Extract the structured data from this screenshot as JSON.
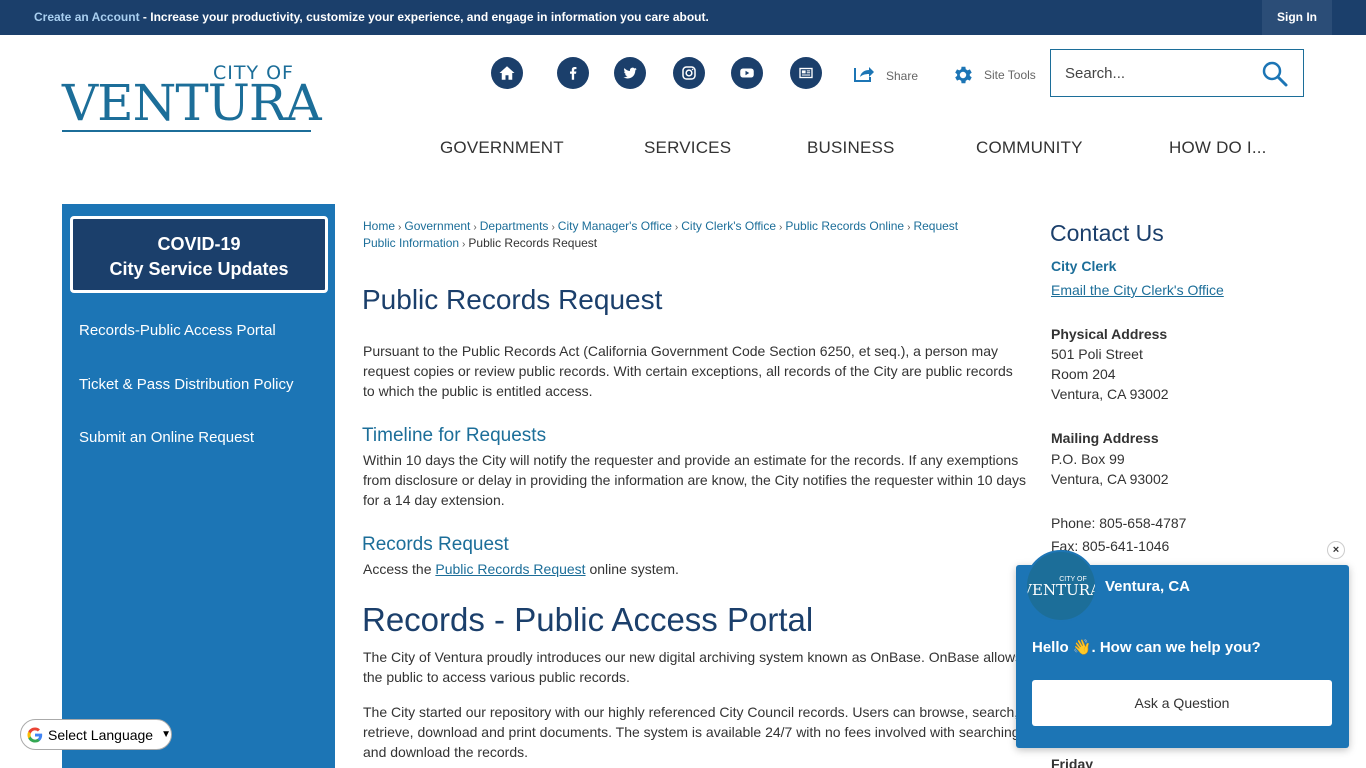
{
  "topbar": {
    "account_link": "Create an Account",
    "message": " - Increase your productivity, customize your experience, and engage in information you care about.",
    "signin": "Sign In"
  },
  "logo": {
    "city_of": "CITY OF",
    "name": "VENTURA"
  },
  "social": [
    {
      "icon": "home-icon"
    },
    {
      "icon": "facebook-icon"
    },
    {
      "icon": "twitter-icon"
    },
    {
      "icon": "instagram-icon"
    },
    {
      "icon": "youtube-icon"
    },
    {
      "icon": "news-icon"
    }
  ],
  "utility": {
    "share": "Share",
    "site_tools": "Site Tools"
  },
  "search": {
    "placeholder": "Search..."
  },
  "nav": [
    "GOVERNMENT",
    "SERVICES",
    "BUSINESS",
    "COMMUNITY",
    "HOW DO I..."
  ],
  "sidebar": {
    "covid_line1": "COVID-19",
    "covid_line2": "City Service Updates",
    "links": [
      "Records-Public Access Portal",
      "Ticket & Pass Distribution Policy",
      "Submit an Online Request"
    ]
  },
  "breadcrumb": {
    "items": [
      "Home",
      "Government",
      "Departments",
      "City Manager's Office",
      "City Clerk's Office",
      "Public Records Online",
      "Request",
      "Public Information"
    ],
    "current": "Public Records Request"
  },
  "main": {
    "title": "Public Records Request",
    "intro": " Pursuant to the Public Records Act (California Government Code Section 6250, et seq.), a person may request copies or review public records. With certain exceptions, all records of the City are public records to which the public is entitled access.",
    "timeline_heading": "Timeline for Requests",
    "timeline_text": "Within 10 days the City will notify the requester and provide an estimate for the records.  If any exemptions from disclosure or delay in providing the information are know, the City notifies the requester within 10 days for a 14 day extension.",
    "records_heading": "Records Request",
    "access_prefix": "Access the ",
    "access_link": "Public Records Request",
    "access_suffix": " online system.",
    "portal_heading": "Records - Public Access Portal",
    "portal_p1": "The City of Ventura proudly introduces our new digital archiving system known as OnBase.  OnBase allows the public to access various public records.",
    "portal_p2": "The City started our repository with our highly referenced City Council records.  Users can browse, search, retrieve, download and print documents.  The system is available 24/7 with no fees involved with searching and download the records."
  },
  "contact": {
    "title": "Contact Us",
    "dept": "City Clerk",
    "email_link": "Email the City Clerk's Office",
    "physical_label": "Physical Address",
    "physical_lines": [
      "501 Poli Street",
      "Room 204",
      "Ventura, CA 93002"
    ],
    "mailing_label": "Mailing Address",
    "mailing_lines": [
      "P.O. Box 99",
      "Ventura, CA 93002"
    ],
    "phone": "Phone: 805-658-4787",
    "fax": "Fax: 805-641-1046",
    "hours_partial": "Friday"
  },
  "chat": {
    "name": "Ventura, CA",
    "greeting": "Hello 👋. How can we help you?",
    "button": "Ask a Question",
    "close": "×"
  },
  "translate": {
    "label": "Select Language"
  }
}
